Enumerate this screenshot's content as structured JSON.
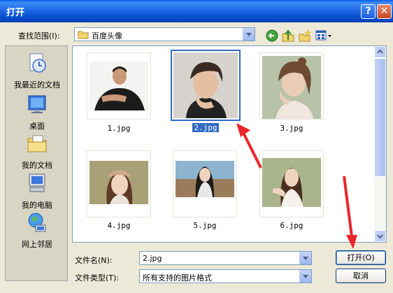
{
  "window": {
    "title": "打开",
    "help": "?",
    "close": "✕"
  },
  "lookin": {
    "label": "查找范围(I):",
    "value": "百度头像"
  },
  "toolbar": {
    "back": "back-icon",
    "up": "up-folder-icon",
    "newfolder": "new-folder-icon",
    "view": "view-menu-icon"
  },
  "places": [
    {
      "label": "我最近的文档",
      "icon": "recent-documents-icon"
    },
    {
      "label": "桌面",
      "icon": "desktop-icon"
    },
    {
      "label": "我的文档",
      "icon": "my-documents-icon"
    },
    {
      "label": "我的电脑",
      "icon": "my-computer-icon"
    },
    {
      "label": "网上邻居",
      "icon": "network-places-icon"
    }
  ],
  "files": [
    {
      "name": "1.jpg",
      "selected": false
    },
    {
      "name": "2.jpg",
      "selected": true
    },
    {
      "name": "3.jpg",
      "selected": false
    },
    {
      "name": "4.jpg",
      "selected": false
    },
    {
      "name": "5.jpg",
      "selected": false
    },
    {
      "name": "6.jpg",
      "selected": false
    }
  ],
  "filename": {
    "label": "文件名(N):",
    "value": "2.jpg"
  },
  "filetype": {
    "label": "文件类型(T):",
    "value": "所有支持的图片格式"
  },
  "buttons": {
    "open": "打开(O)",
    "cancel": "取消"
  },
  "annotation": {
    "color": "#E8262B"
  }
}
